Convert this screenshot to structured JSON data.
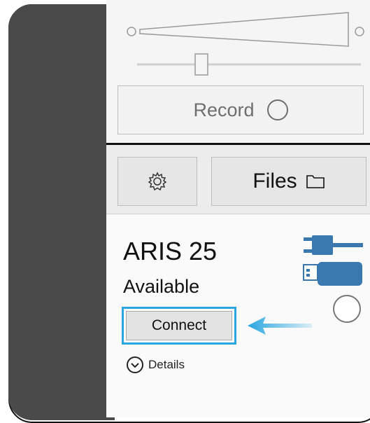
{
  "recorder": {
    "record_label": "Record",
    "settings_icon": "gear-icon",
    "files_label": "Files",
    "files_icon": "folder-icon"
  },
  "device": {
    "name": "ARIS 25",
    "status": "Available",
    "connect_label": "Connect",
    "details_label": "Details",
    "connection_icons": [
      "plug-icon",
      "usb-icon"
    ]
  },
  "colors": {
    "highlight": "#29a6e0",
    "device_icon": "#3a78b0",
    "left_panel": "#4a4a4a"
  }
}
